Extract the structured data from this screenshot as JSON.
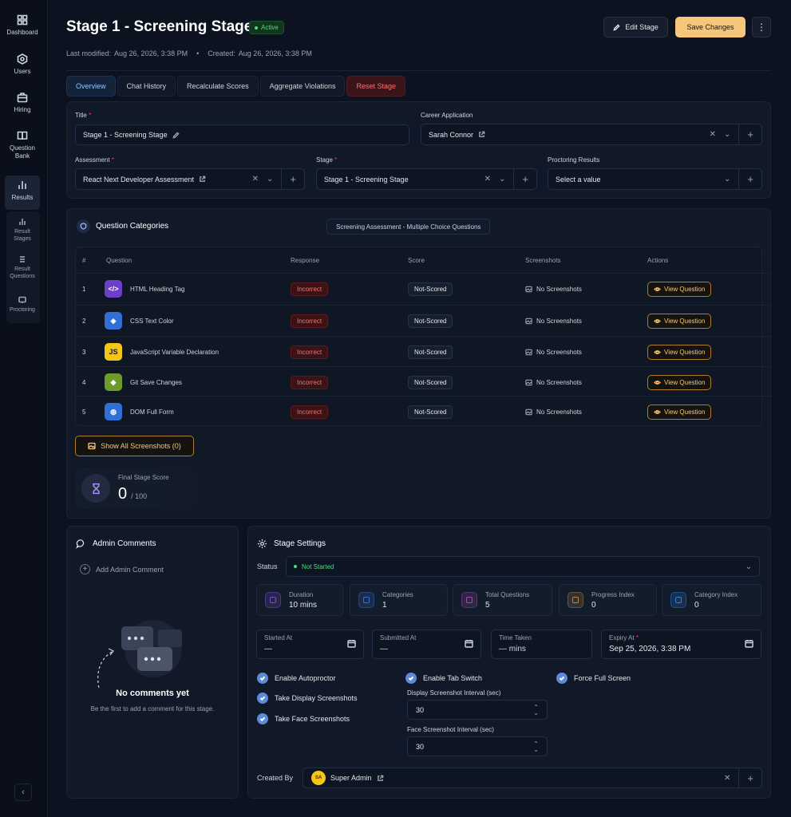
{
  "sidebar": {
    "items": [
      {
        "label": "Dashboard",
        "icon": "grid-icon"
      },
      {
        "label": "Users",
        "icon": "hexagon-icon"
      },
      {
        "label": "Hiring",
        "icon": "briefcase-icon"
      },
      {
        "label": "Question Bank",
        "icon": "book-icon"
      },
      {
        "label": "Results",
        "icon": "bar-chart-icon"
      }
    ],
    "subitems": [
      {
        "label": "Result Stages"
      },
      {
        "label": "Result Questions"
      },
      {
        "label": "Proctoring"
      }
    ]
  },
  "header": {
    "title": "Stage 1 - Screening Stage",
    "status": "Active",
    "last_modified_label": "Last modified:",
    "last_modified": "Aug 26, 2026, 3:38 PM",
    "created_label": "Created:",
    "created": "Aug 26, 2026, 3:38 PM",
    "edit_label": "Edit Stage",
    "save_label": "Save Changes"
  },
  "tabs": [
    {
      "label": "Overview"
    },
    {
      "label": "Chat History"
    },
    {
      "label": "Recalculate Scores"
    },
    {
      "label": "Aggregate Violations"
    },
    {
      "label": "Reset Stage"
    }
  ],
  "form": {
    "title_label": "Title",
    "title_value": "Stage 1 - Screening Stage",
    "career_label": "Career Application",
    "career_value": "Sarah Connor",
    "assessment_label": "Assessment",
    "assessment_value": "React Next Developer Assessment",
    "stage_label": "Stage",
    "stage_value": "Stage 1 - Screening Stage",
    "proctoring_label": "Proctoring Results",
    "proctoring_placeholder": "Select a value"
  },
  "categories": {
    "title": "Question Categories",
    "active_category": "Screening Assessment - Multiple Choice Questions",
    "columns": [
      "#",
      "Question",
      "Response",
      "Score",
      "Screenshots",
      "Actions"
    ],
    "rows": [
      {
        "num": "1",
        "question": "HTML Heading Tag",
        "response": "Incorrect",
        "score": "Not-Scored",
        "screenshots": "No Screenshots",
        "action": "View Question",
        "icon": "code-icon",
        "color": "#6d3fc8"
      },
      {
        "num": "2",
        "question": "CSS Text Color",
        "response": "Incorrect",
        "score": "Not-Scored",
        "screenshots": "No Screenshots",
        "action": "View Question",
        "icon": "css-icon",
        "color": "#2f6fd6"
      },
      {
        "num": "3",
        "question": "JavaScript Variable Declaration",
        "response": "Incorrect",
        "score": "Not-Scored",
        "screenshots": "No Screenshots",
        "action": "View Question",
        "icon": "js-icon",
        "color": "#f5c518"
      },
      {
        "num": "4",
        "question": "Git Save Changes",
        "response": "Incorrect",
        "score": "Not-Scored",
        "screenshots": "No Screenshots",
        "action": "View Question",
        "icon": "git-icon",
        "color": "#6e9b2c"
      },
      {
        "num": "5",
        "question": "DOM Full Form",
        "response": "Incorrect",
        "score": "Not-Scored",
        "screenshots": "No Screenshots",
        "action": "View Question",
        "icon": "globe-icon",
        "color": "#2f6fd6"
      }
    ],
    "show_screenshots": "Show All Screenshots (0)",
    "final_label": "Final Stage Score",
    "final_score": "0",
    "final_max": "/ 100"
  },
  "comments": {
    "title": "Admin Comments",
    "add_label": "Add Admin Comment",
    "empty_title": "No comments yet",
    "empty_sub": "Be the first to add a comment for this stage."
  },
  "settings": {
    "title": "Stage Settings",
    "status_label": "Status",
    "status_value": "Not Started",
    "stats": [
      {
        "label": "Duration",
        "value": "10 mins",
        "icon": "clock-icon",
        "color": "#7c4dcf"
      },
      {
        "label": "Categories",
        "value": "1",
        "icon": "folder-icon",
        "color": "#3a6bd1"
      },
      {
        "label": "Total Questions",
        "value": "5",
        "icon": "cluster-icon",
        "color": "#a14fb4"
      },
      {
        "label": "Progress Index",
        "value": "0",
        "icon": "progress-icon",
        "color": "#b88a45"
      },
      {
        "label": "Category Index",
        "value": "0",
        "icon": "target-icon",
        "color": "#2f7fe0"
      }
    ],
    "started_label": "Started At",
    "started_value": "—",
    "submitted_label": "Submitted At",
    "submitted_value": "—",
    "time_label": "Time Taken",
    "time_value": "— mins",
    "expiry_label": "Expiry At",
    "expiry_value": "Sep 25, 2026, 3:38 PM",
    "checks": {
      "autoproctor": "Enable Autoproctor",
      "display_shots": "Take Display Screenshots",
      "face_shots": "Take Face Screenshots",
      "tab_switch": "Enable Tab Switch",
      "full_screen": "Force Full Screen"
    },
    "display_interval_label": "Display Screenshot Interval (sec)",
    "display_interval": "30",
    "face_interval_label": "Face Screenshot Interval (sec)",
    "face_interval": "30",
    "created_by_label": "Created By",
    "created_by_initials": "SA",
    "created_by": "Super Admin"
  }
}
